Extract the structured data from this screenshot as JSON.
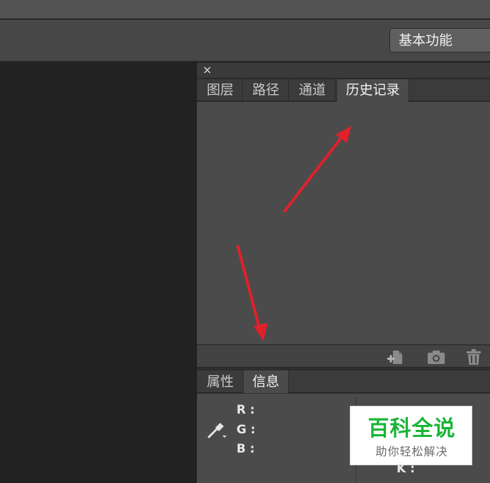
{
  "workspace": {
    "selected": "基本功能"
  },
  "panel_close_icon": "×",
  "top_panel": {
    "tabs": [
      {
        "label": "图层"
      },
      {
        "label": "路径"
      },
      {
        "label": "通道"
      },
      {
        "label": "历史记录"
      }
    ],
    "active_tab": "历史记录",
    "footer_icons": [
      "new-document-from-state-icon",
      "camera-snapshot-icon",
      "trash-icon"
    ]
  },
  "bottom_panel": {
    "tabs": [
      {
        "label": "属性"
      },
      {
        "label": "信息"
      }
    ],
    "active_tab": "信息",
    "info": {
      "labels": [
        "R :",
        "G :",
        "B :"
      ],
      "partial_right": [
        "K :"
      ]
    }
  },
  "watermark": {
    "title": "百科全说",
    "subtitle": "助你轻松解决"
  },
  "colors": {
    "annotation_arrow": "#e0212b",
    "watermark_green": "#18b536"
  }
}
